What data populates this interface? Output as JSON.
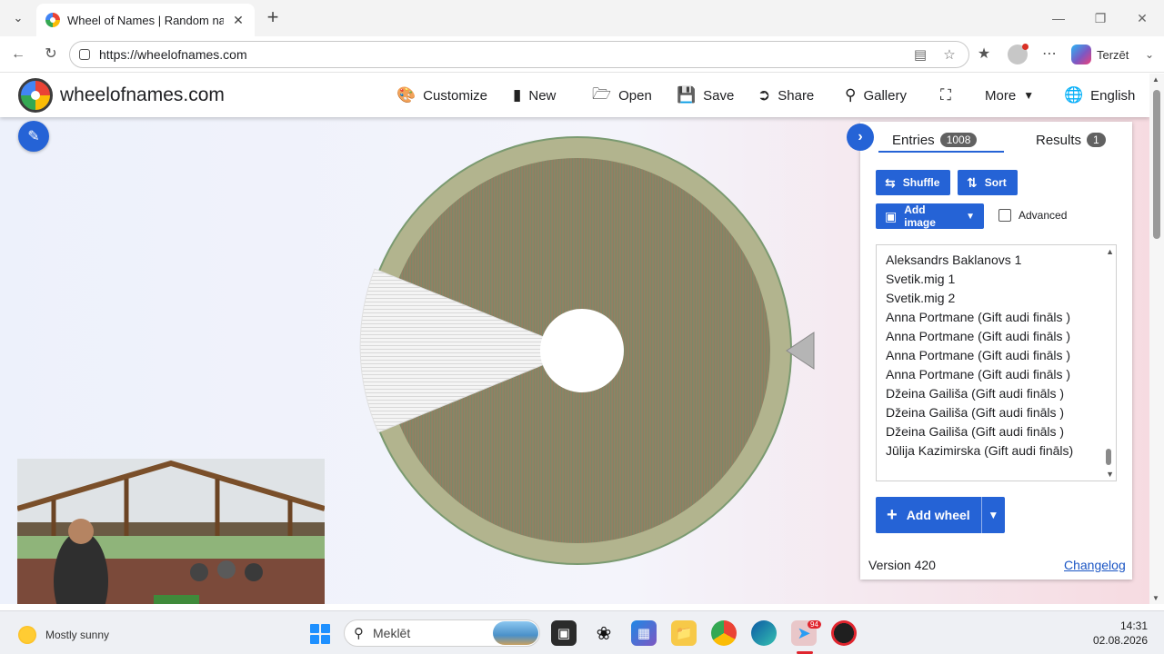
{
  "browser": {
    "tab_title": "Wheel of Names | Random name picker",
    "url": "https://wheelofnames.com",
    "copilot_label": "Terzēt"
  },
  "header": {
    "site_name": "wheelofnames.com",
    "menu": [
      {
        "label": "Customize",
        "icon": "palette-icon"
      },
      {
        "label": "New",
        "icon": "file-icon"
      },
      {
        "label": "Open",
        "icon": "folder-icon"
      },
      {
        "label": "Save",
        "icon": "save-icon"
      },
      {
        "label": "Share",
        "icon": "share-icon"
      },
      {
        "label": "Gallery",
        "icon": "search-icon"
      },
      {
        "label": "",
        "icon": "fullscreen-icon"
      },
      {
        "label": "More",
        "icon": "chevron-down-icon"
      },
      {
        "label": "English",
        "icon": "globe-icon"
      }
    ]
  },
  "panel": {
    "entries_tab": "Entries",
    "entries_count": "1008",
    "results_tab": "Results",
    "results_count": "1",
    "shuffle_label": "Shuffle",
    "sort_label": "Sort",
    "add_image_label": "Add image",
    "advanced_label": "Advanced",
    "entries": [
      "Aleksandrs Baklanovs 1",
      "Svetik.mig 1",
      "Svetik.mig 2",
      "Anna Portmane (Gift audi fināls )",
      "Anna Portmane (Gift audi fināls )",
      "Anna Portmane (Gift audi fināls )",
      "Anna Portmane (Gift audi fināls )",
      "Džeina Gailiša (Gift audi fināls )",
      "Džeina Gailiša (Gift audi fināls )",
      "Džeina Gailiša (Gift audi fināls )",
      "Jūlija Kazimirska (Gift audi fināls)"
    ],
    "add_wheel_label": "Add wheel",
    "version": "Version 420",
    "changelog": "Changelog"
  },
  "colors": {
    "accent": "#2563d6",
    "wheel_fill": "#8f8668",
    "wheel_rim": "#9aa07a"
  },
  "taskbar": {
    "weather": "Mostly sunny",
    "search_placeholder": "Meklēt",
    "telegram_badge": "94",
    "time": "14:31",
    "date": "02.08.2026"
  }
}
